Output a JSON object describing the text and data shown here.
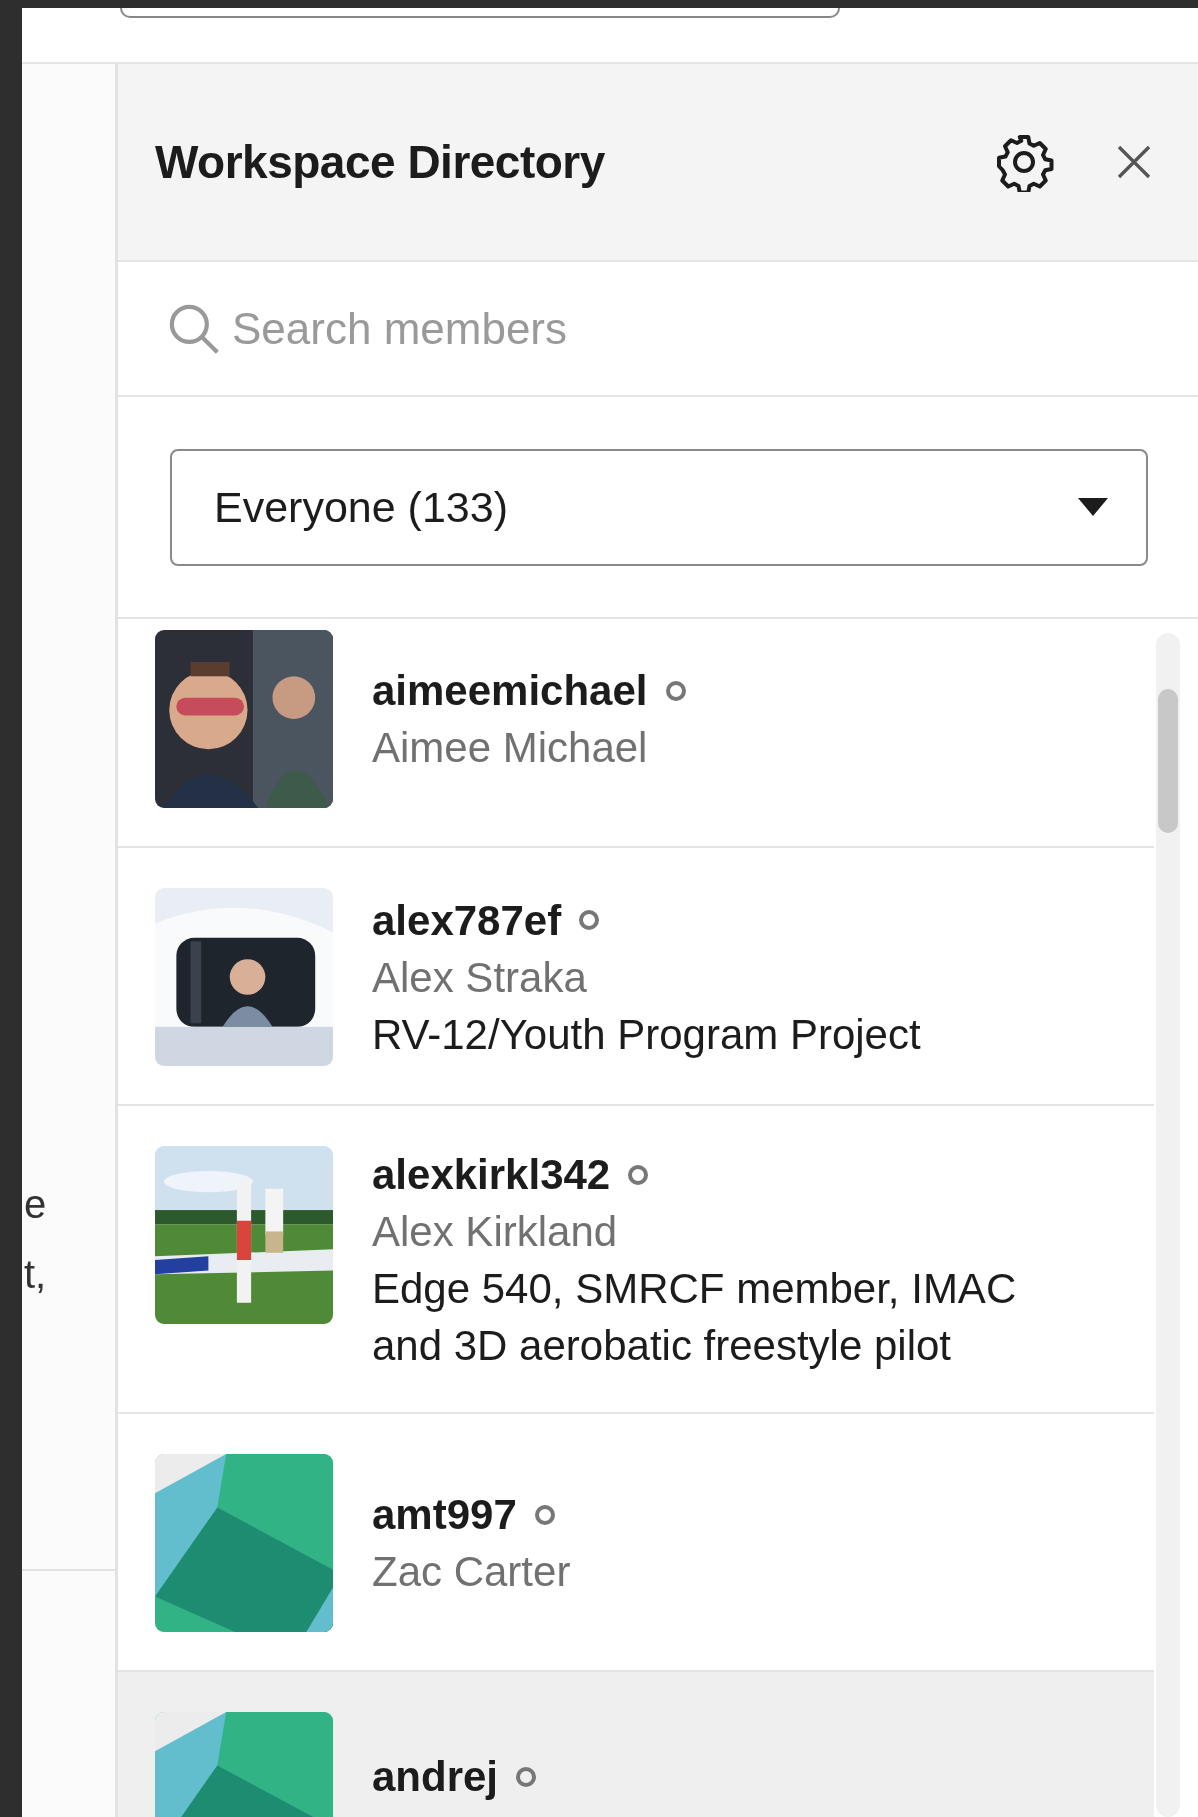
{
  "left_pane": {
    "fragments": [
      "e",
      "t,"
    ]
  },
  "directory": {
    "title": "Workspace Directory",
    "search": {
      "placeholder": "Search members"
    },
    "filter": {
      "value": "Everyone (133)"
    },
    "members": [
      {
        "username": "aimeemichael",
        "away": true,
        "real_name": "Aimee Michael",
        "highlighted": false
      },
      {
        "username": "alex787ef",
        "away": true,
        "real_name": "Alex Straka",
        "title": "RV-12/Youth Program Project",
        "highlighted": false
      },
      {
        "username": "alexkirkl342",
        "away": true,
        "real_name": "Alex Kirkland",
        "title": "Edge 540, SMRCF member, IMAC and 3D aerobatic freestyle pilot",
        "highlighted": false
      },
      {
        "username": "amt997",
        "away": true,
        "real_name": "Zac Carter",
        "avatar": {
          "kind": "default"
        },
        "highlighted": false
      },
      {
        "username": "andrej",
        "away": true,
        "avatar": {
          "kind": "default"
        },
        "highlighted": true
      }
    ]
  }
}
